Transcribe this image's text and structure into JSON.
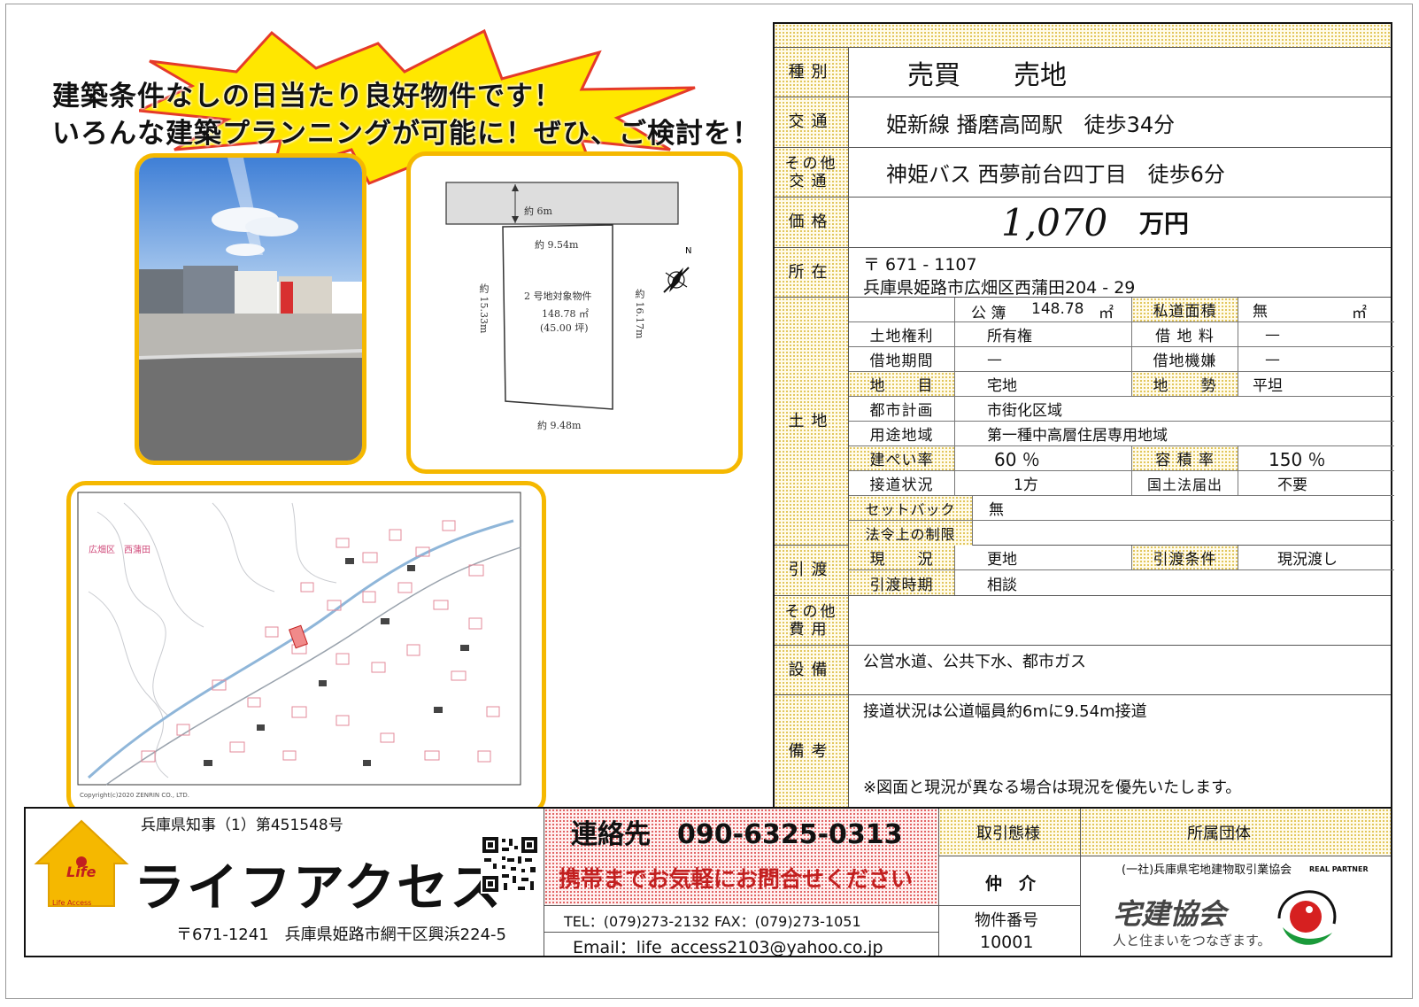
{
  "headline": {
    "line1": "建築条件なしの日当たり良好物件です！",
    "line2": "いろんな建築プランニングが可能に！ぜひ、ご検討を！"
  },
  "plan": {
    "road": "約 6m",
    "top": "約 9.54m",
    "left": "約 15.33m",
    "right": "約 16.17m",
    "bottom": "約 9.48m",
    "lot_name": "2 号地対象物件",
    "area": "148.78 ㎡",
    "tsubo": "(45.00 坪)"
  },
  "map": {
    "district": "広畑区　西蒲田",
    "copyright": "Copyright(c)2020 ZENRIN CO., LTD."
  },
  "spec": {
    "type_label": "種別",
    "type_value1": "売買",
    "type_value2": "売地",
    "transport_label": "交通",
    "transport_value": "姫新線 播磨高岡駅　徒歩34分",
    "other_transport_label1": "その他",
    "other_transport_label2": "交通",
    "other_transport_value": "神姫バス 西夢前台四丁目　徒歩6分",
    "price_label": "価格",
    "price_number": "1,070",
    "price_unit": "万円",
    "address_label": "所在",
    "postal": "〒 671 - 1107",
    "address": "兵庫県姫路市広畑区西蒲田204 - 29",
    "land_label": "土地",
    "land": {
      "area_label": "公 簿",
      "area_value": "148.78",
      "area_unit": "㎡",
      "private_road_label": "私道面積",
      "private_road_value": "無",
      "private_road_unit": "㎡",
      "rights_label": "土地権利",
      "rights_value": "所有権",
      "lease_fee_label": "借 地 料",
      "lease_fee_value": "—",
      "lease_period_label": "借地期間",
      "lease_period_value": "—",
      "lease_mechanism_label": "借地機嫌",
      "lease_mechanism_value": "—",
      "category_label": "地　　目",
      "category_value": "宅地",
      "terrain_label": "地　　勢",
      "terrain_value": "平坦",
      "city_plan_label": "都市計画",
      "city_plan_value": "市街化区域",
      "zoning_label": "用途地域",
      "zoning_value": "第一種中高層住居専用地域",
      "coverage_label": "建ぺい率",
      "coverage_value": "60 ％",
      "far_label": "容 積 率",
      "far_value": "150 ％",
      "road_access_label": "接道状況",
      "road_access_value": "1方",
      "notification_label": "国土法届出",
      "notification_value": "不要",
      "setback_label": "セットバック",
      "setback_value": "無",
      "restrictions_label": "法令上の制限",
      "restrictions_value": ""
    },
    "delivery_label": "引渡",
    "delivery": {
      "status_label": "現　　況",
      "status_value": "更地",
      "condition_label": "引渡条件",
      "condition_value": "現況渡し",
      "timing_label": "引渡時期",
      "timing_value": "相談"
    },
    "other_cost_label1": "その他",
    "other_cost_label2": "費用",
    "other_cost_value": "",
    "facility_label": "設備",
    "facility_value": "公営水道、公共下水、都市ガス",
    "remarks_label": "備考",
    "remarks_value1": "接道状況は公道幅員約6mに9.54m接道",
    "remarks_value2": "※図面と現況が異なる場合は現況を優先いたします。"
  },
  "footer": {
    "license": "兵庫県知事（1）第451548号",
    "company": "ライフアクセス",
    "logo_text1": "Life",
    "logo_text2": "Life Access",
    "company_address": "〒671-1241　兵庫県姫路市網干区興浜224-5",
    "contact": "連絡先　090-6325-0313",
    "contact_note": "携帯までお気軽にお問合せください",
    "tel_fax": "TEL：(079)273-2132  FAX：(079)273-1051",
    "email": "Email：life_access2103@yahoo.co.jp",
    "deal_label": "取引態様",
    "deal_value": "仲　介",
    "number_label": "物件番号",
    "number_value": "10001",
    "org_label": "所属団体",
    "org_name": "(一社)兵庫県宅地建物取引業協会",
    "org_logo": "宅建協会",
    "org_tagline": "人と住まいをつなぎます。",
    "partner_text": "REAL PARTNER"
  },
  "colors": {
    "frame": "#f5b800",
    "burst": "#ffe700",
    "burst_stroke": "#e53a2a",
    "dot": "#e0c250",
    "red": "#c21f1f"
  }
}
